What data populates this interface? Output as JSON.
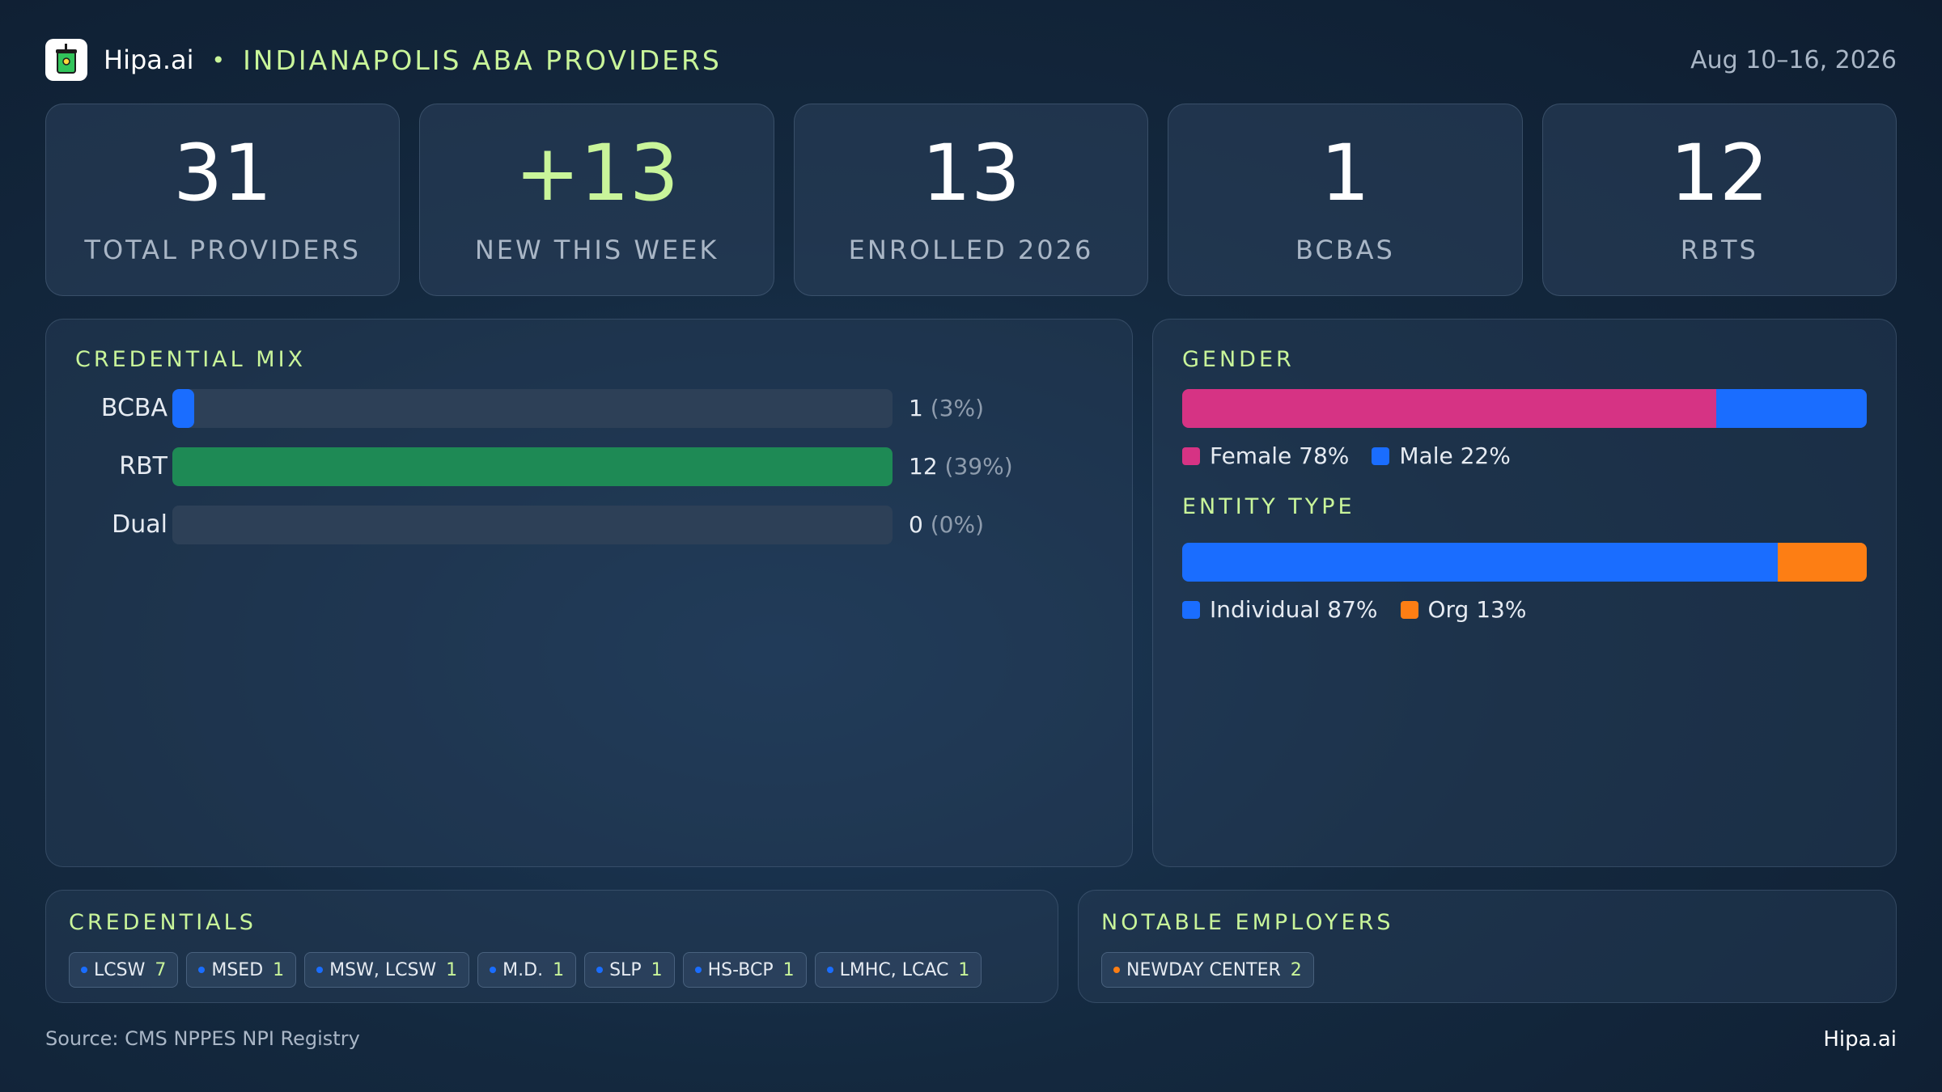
{
  "header": {
    "brand": "Hipa.ai",
    "separator": "•",
    "title": "INDIANAPOLIS ABA PROVIDERS",
    "date_range": "Aug 10–16, 2026",
    "logo_icon": "cup-icon"
  },
  "kpis": [
    {
      "value": "31",
      "label": "TOTAL PROVIDERS"
    },
    {
      "value": "+13",
      "label": "NEW THIS WEEK",
      "accent": true
    },
    {
      "value": "13",
      "label": "ENROLLED 2026"
    },
    {
      "value": "1",
      "label": "BCBAS"
    },
    {
      "value": "12",
      "label": "RBTS"
    }
  ],
  "credential_mix": {
    "title": "CREDENTIAL MIX",
    "rows": [
      {
        "label": "BCBA",
        "count": "1",
        "pct": "(3%)",
        "fraction": 0.03,
        "color": "#1a6dff"
      },
      {
        "label": "RBT",
        "count": "12",
        "pct": "(39%)",
        "fraction": 1.0,
        "color": "#1e8a55"
      },
      {
        "label": "Dual",
        "count": "0",
        "pct": "(0%)",
        "fraction": 0.0,
        "color": "#1a6dff"
      }
    ]
  },
  "gender": {
    "title": "GENDER",
    "segments": [
      {
        "label": "Female 78%",
        "fraction": 0.78,
        "color": "#d63384"
      },
      {
        "label": "Male 22%",
        "fraction": 0.22,
        "color": "#1a6dff"
      }
    ]
  },
  "entity_type": {
    "title": "ENTITY TYPE",
    "segments": [
      {
        "label": "Individual 87%",
        "fraction": 0.87,
        "color": "#1a6dff"
      },
      {
        "label": "Org 13%",
        "fraction": 0.13,
        "color": "#fd7e14"
      }
    ]
  },
  "credentials": {
    "title": "CREDENTIALS",
    "chips": [
      {
        "label": "LCSW",
        "count": "7"
      },
      {
        "label": "MSED",
        "count": "1"
      },
      {
        "label": "MSW, LCSW",
        "count": "1"
      },
      {
        "label": "M.D.",
        "count": "1"
      },
      {
        "label": "SLP",
        "count": "1"
      },
      {
        "label": "HS-BCP",
        "count": "1"
      },
      {
        "label": "LMHC, LCAC",
        "count": "1"
      }
    ],
    "dot_color": "#1a6dff"
  },
  "employers": {
    "title": "NOTABLE EMPLOYERS",
    "chips": [
      {
        "label": "NEWDAY CENTER",
        "count": "2"
      }
    ],
    "dot_color": "#fd7e14"
  },
  "footer": {
    "source": "Source: CMS NPPES NPI Registry",
    "brand": "Hipa.ai"
  }
}
